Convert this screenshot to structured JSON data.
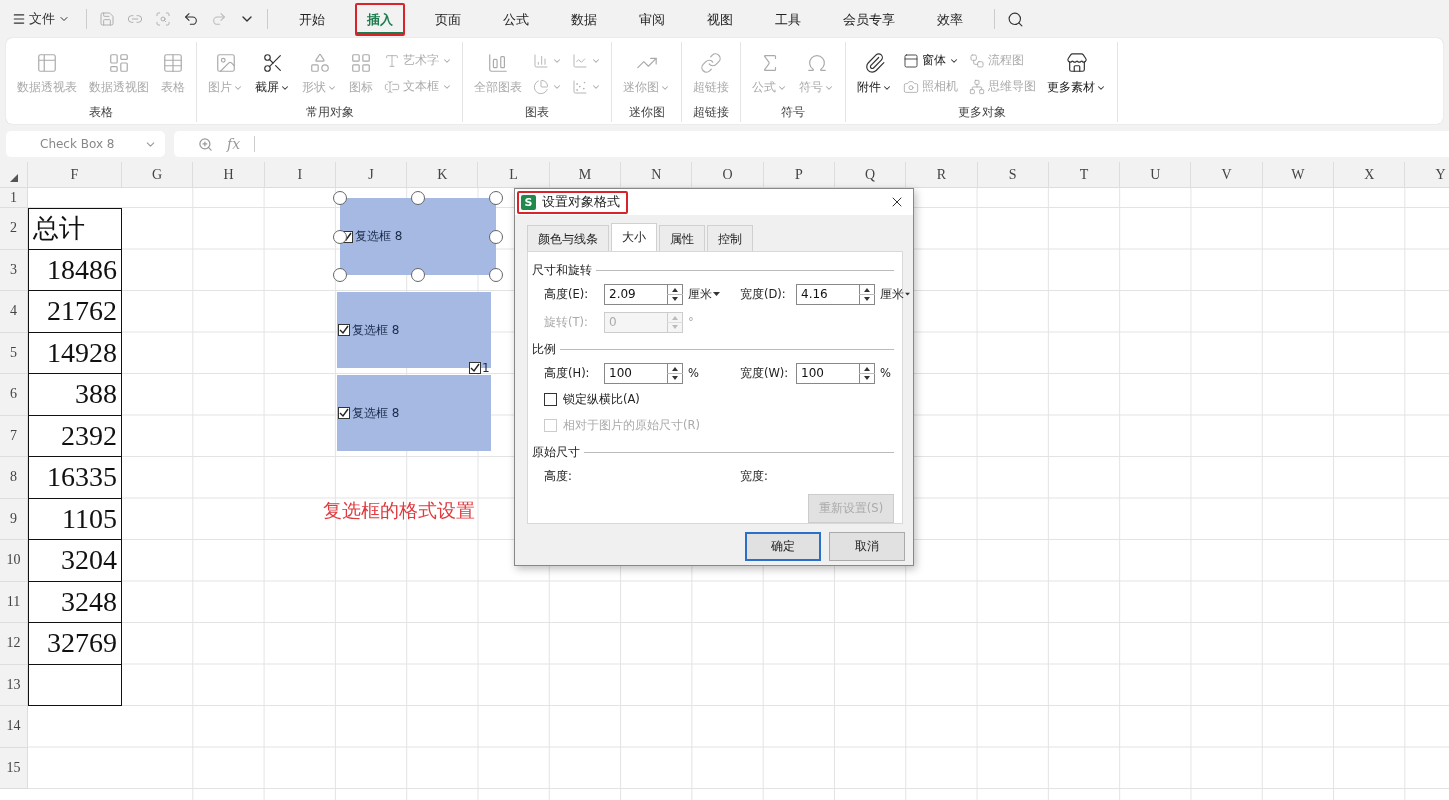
{
  "menubar": {
    "file_label": "文件",
    "tabs": [
      {
        "label": "开始",
        "selected": false,
        "highlighted": false
      },
      {
        "label": "插入",
        "selected": true,
        "highlighted": true
      },
      {
        "label": "页面",
        "selected": false,
        "highlighted": false
      },
      {
        "label": "公式",
        "selected": false,
        "highlighted": false
      },
      {
        "label": "数据",
        "selected": false,
        "highlighted": false
      },
      {
        "label": "审阅",
        "selected": false,
        "highlighted": false
      },
      {
        "label": "视图",
        "selected": false,
        "highlighted": false
      },
      {
        "label": "工具",
        "selected": false,
        "highlighted": false
      },
      {
        "label": "会员专享",
        "selected": false,
        "highlighted": false
      },
      {
        "label": "效率",
        "selected": false,
        "highlighted": false
      }
    ]
  },
  "ribbon": {
    "groups": [
      {
        "label": "表格",
        "items": [
          {
            "kind": "large",
            "label": "数据透视表",
            "disabled": true,
            "dropdown": false
          },
          {
            "kind": "large",
            "label": "数据透视图",
            "disabled": true,
            "dropdown": false
          },
          {
            "kind": "large",
            "label": "表格",
            "disabled": true,
            "dropdown": false
          }
        ]
      },
      {
        "label": "常用对象",
        "items": [
          {
            "kind": "large",
            "label": "图片",
            "disabled": true,
            "dropdown": true
          },
          {
            "kind": "large",
            "label": "截屏",
            "disabled": false,
            "dropdown": true
          },
          {
            "kind": "large",
            "label": "形状",
            "disabled": true,
            "dropdown": true
          },
          {
            "kind": "large",
            "label": "图标",
            "disabled": true,
            "dropdown": false
          },
          {
            "kind": "small",
            "label": "艺术字",
            "disabled": true,
            "dropdown": true
          },
          {
            "kind": "small",
            "label": "文本框",
            "disabled": true,
            "dropdown": true
          }
        ]
      },
      {
        "label": "图表",
        "items": [
          {
            "kind": "large",
            "label": "全部图表",
            "disabled": true,
            "dropdown": false
          },
          {
            "kind": "small",
            "disabled": true,
            "dropdown": true
          },
          {
            "kind": "small",
            "disabled": true,
            "dropdown": true
          },
          {
            "kind": "small",
            "disabled": true,
            "dropdown": true
          },
          {
            "kind": "small",
            "disabled": true,
            "dropdown": true
          }
        ]
      },
      {
        "label": "迷你图",
        "items": [
          {
            "kind": "large",
            "label": "迷你图",
            "disabled": true,
            "dropdown": true
          }
        ]
      },
      {
        "label": "超链接",
        "items": [
          {
            "kind": "large",
            "label": "超链接",
            "disabled": true,
            "dropdown": false
          }
        ]
      },
      {
        "label": "符号",
        "items": [
          {
            "kind": "large",
            "label": "公式",
            "disabled": true,
            "dropdown": true
          },
          {
            "kind": "large",
            "label": "符号",
            "disabled": true,
            "dropdown": true
          }
        ]
      },
      {
        "label": "更多对象",
        "items": [
          {
            "kind": "large",
            "label": "附件",
            "disabled": false,
            "dropdown": true
          },
          {
            "kind": "small",
            "label": "窗体",
            "disabled": false,
            "dropdown": true
          },
          {
            "kind": "small",
            "label": "照相机",
            "disabled": true,
            "dropdown": false
          },
          {
            "kind": "small",
            "label": "流程图",
            "disabled": true,
            "dropdown": false
          },
          {
            "kind": "small",
            "label": "思维导图",
            "disabled": true,
            "dropdown": false
          },
          {
            "kind": "large",
            "label": "更多素材",
            "disabled": false,
            "dropdown": true
          }
        ]
      }
    ]
  },
  "formula_bar": {
    "name_box": "Check Box 8",
    "fx_label": "fx"
  },
  "sheet": {
    "columns": [
      "F",
      "G",
      "H",
      "I",
      "J",
      "K",
      "L",
      "M",
      "N",
      "O",
      "P",
      "Q",
      "R",
      "S",
      "T",
      "U",
      "V",
      "W",
      "X",
      "Y"
    ],
    "rows": [
      "1",
      "2",
      "3",
      "4",
      "5",
      "6",
      "7",
      "8",
      "9",
      "10",
      "11",
      "12",
      "13",
      "14",
      "15"
    ],
    "table": {
      "header": "总计",
      "values": [
        "18486",
        "21762",
        "14928",
        "388",
        "2392",
        "16335",
        "1105",
        "3204",
        "3248",
        "32769"
      ]
    },
    "checkbox_objects": [
      {
        "label": "复选框 8",
        "checked": true,
        "selected": true
      },
      {
        "label": "复选框 8",
        "checked": true,
        "selected": false
      },
      {
        "label": "复选框 8",
        "checked": true,
        "selected": false
      }
    ],
    "small_checkbox": {
      "label": "1",
      "checked": true
    },
    "annotation": "复选框的格式设置"
  },
  "dialog": {
    "app_letter": "S",
    "title": "设置对象格式",
    "title_highlighted": true,
    "tabs": [
      {
        "label": "颜色与线条",
        "selected": false
      },
      {
        "label": "大小",
        "selected": true
      },
      {
        "label": "属性",
        "selected": false
      },
      {
        "label": "控制",
        "selected": false
      }
    ],
    "sections": [
      {
        "title": "尺寸和旋转",
        "rows": [
          [
            {
              "label": "高度(E):",
              "value": "2.09",
              "unit": "厘米",
              "unit_dropdown": true,
              "disabled": false
            },
            {
              "label": "宽度(D):",
              "value": "4.16",
              "unit": "厘米",
              "unit_dropdown": true,
              "disabled": false
            }
          ],
          [
            {
              "label": "旋转(T):",
              "value": "0",
              "unit": "°",
              "unit_dropdown": false,
              "disabled": true
            }
          ]
        ]
      },
      {
        "title": "比例",
        "rows": [
          [
            {
              "label": "高度(H):",
              "value": "100",
              "unit": "%",
              "unit_dropdown": false,
              "disabled": false
            },
            {
              "label": "宽度(W):",
              "value": "100",
              "unit": "%",
              "unit_dropdown": false,
              "disabled": false
            }
          ]
        ],
        "checkboxes": [
          {
            "label": "锁定纵横比(A)",
            "checked": false,
            "disabled": false
          },
          {
            "label": "相对于图片的原始尺寸(R)",
            "checked": false,
            "disabled": true
          }
        ]
      },
      {
        "title": "原始尺寸",
        "labels": [
          "高度:",
          "宽度:"
        ],
        "button": {
          "label": "重新设置(S)",
          "disabled": true
        }
      }
    ],
    "buttons": [
      {
        "label": "确定",
        "default": true
      },
      {
        "label": "取消",
        "default": false
      }
    ]
  }
}
